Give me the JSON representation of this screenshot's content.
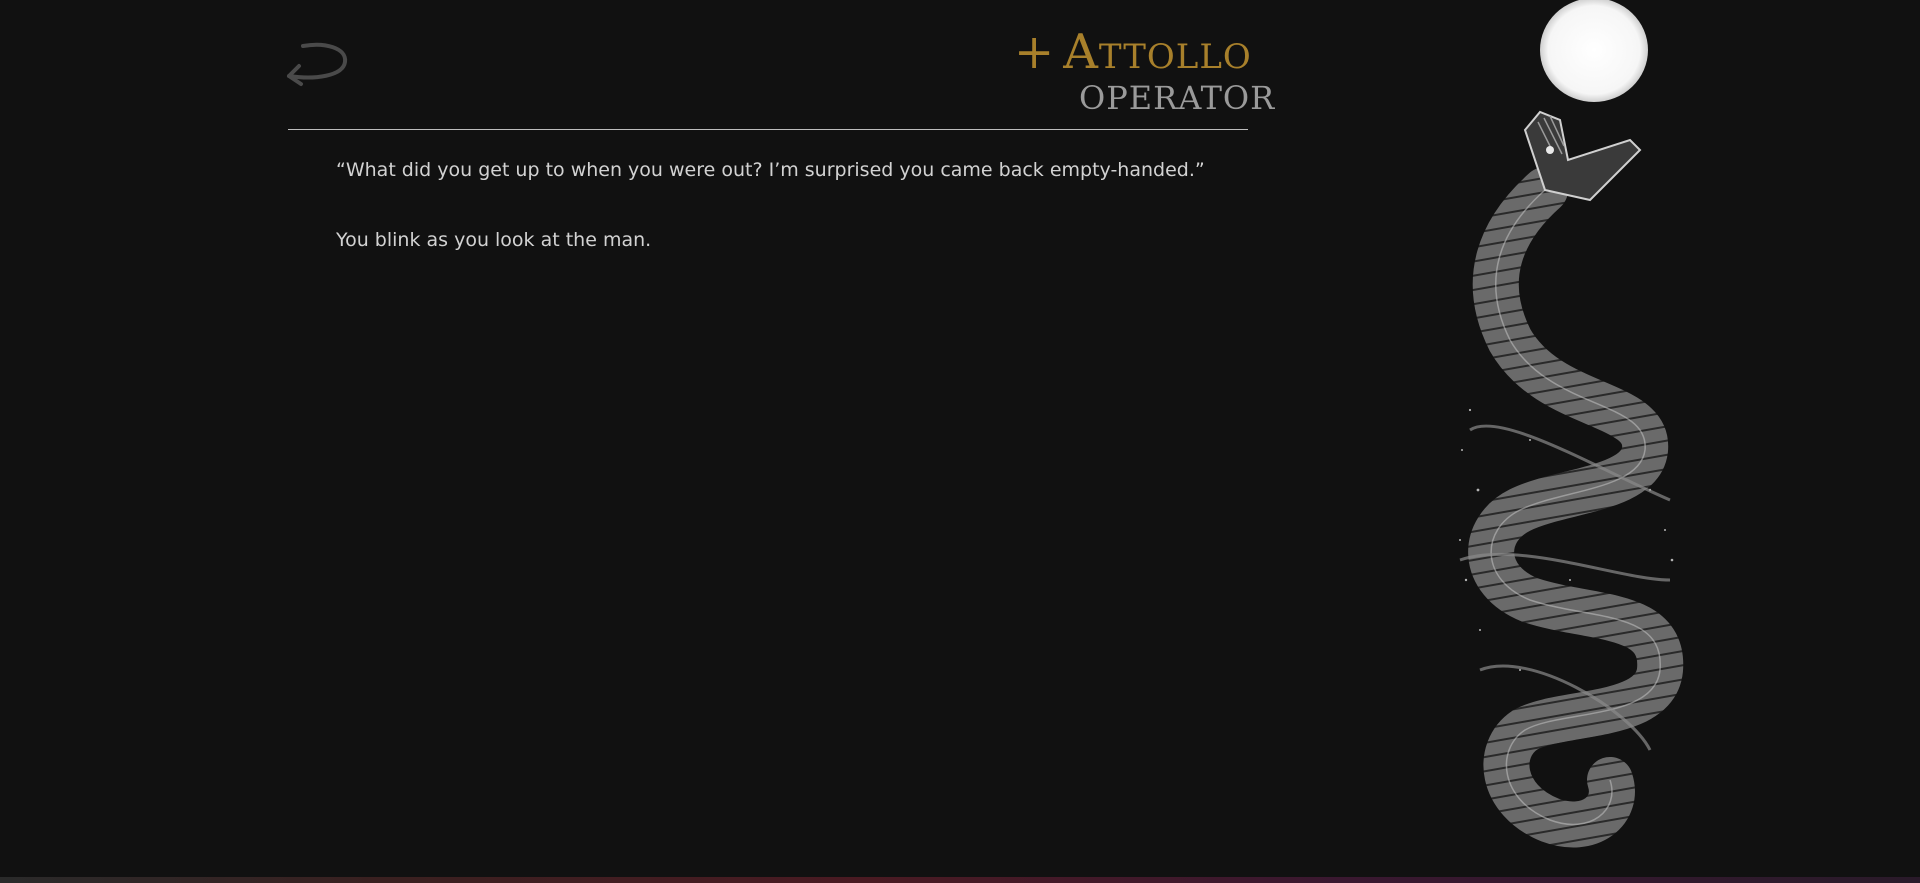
{
  "header": {
    "back_icon": "return-arrow-icon",
    "title_prefix": "+",
    "title": "Attollo",
    "subtitle": "OPERATOR"
  },
  "story": {
    "paragraphs": [
      "“What did you get up to when you were out? I’m surprised you came back empty-handed.”",
      "You blink as you look at the man."
    ]
  },
  "art": {
    "moon_icon": "moon-icon",
    "serpent_icon": "serpent-illustration"
  },
  "colors": {
    "background": "#111111",
    "title_gold": "#a8802b",
    "subtitle_gray": "#9a9a9a",
    "text": "#d2d2d2"
  }
}
